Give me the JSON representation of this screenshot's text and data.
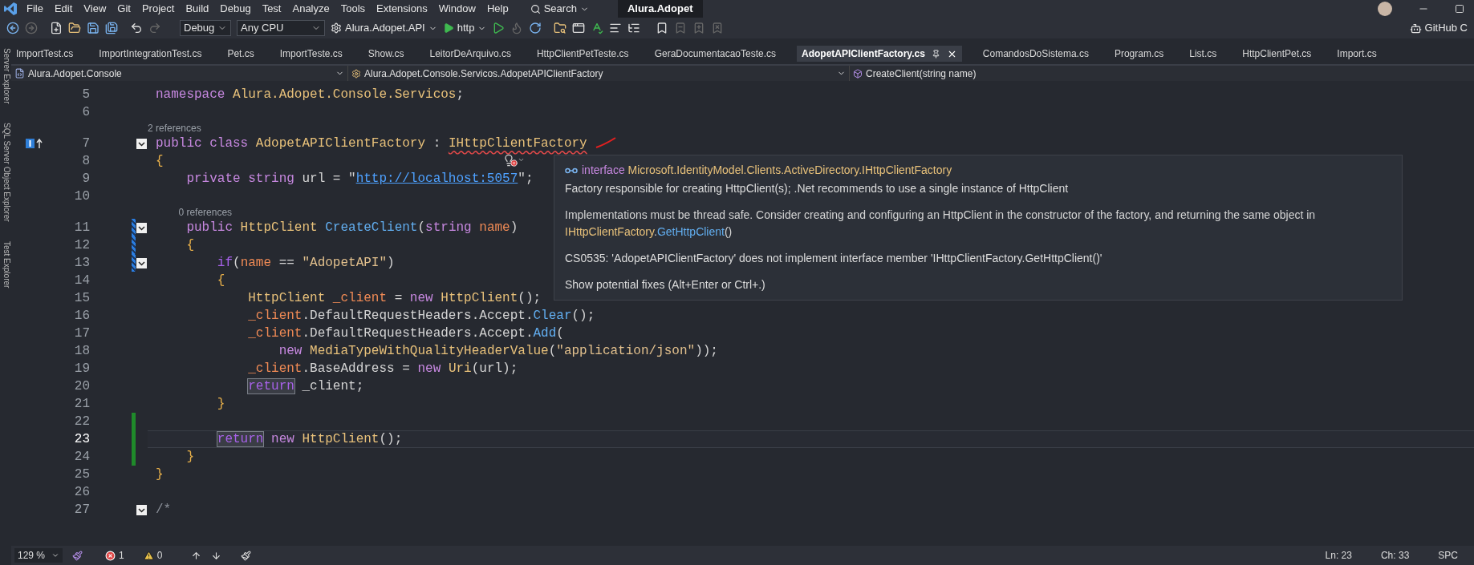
{
  "menu": {
    "items": [
      "File",
      "Edit",
      "View",
      "Git",
      "Project",
      "Build",
      "Debug",
      "Test",
      "Analyze",
      "Tools",
      "Extensions",
      "Window",
      "Help"
    ],
    "search": "Search",
    "solution_title": "Alura.Adopet"
  },
  "toolbar": {
    "configuration": "Debug",
    "platform": "Any CPU",
    "startup_project": "Alura.Adopet.API",
    "launch_profile": "http",
    "account": "GitHub C"
  },
  "side_panels": [
    "Server Explorer",
    "SQL Server Object Explorer",
    "Test Explorer"
  ],
  "tabs": [
    {
      "label": "ImportTest.cs",
      "selected": false
    },
    {
      "label": "ImportIntegrationTest.cs",
      "selected": false
    },
    {
      "label": "Pet.cs",
      "selected": false
    },
    {
      "label": "ImportTeste.cs",
      "selected": false
    },
    {
      "label": "Show.cs",
      "selected": false
    },
    {
      "label": "LeitorDeArquivo.cs",
      "selected": false
    },
    {
      "label": "HttpClientPetTeste.cs",
      "selected": false
    },
    {
      "label": "GeraDocumentacaoTeste.cs",
      "selected": false
    },
    {
      "label": "AdopetAPIClientFactory.cs",
      "selected": true
    },
    {
      "label": "ComandosDoSistema.cs",
      "selected": false
    },
    {
      "label": "Program.cs",
      "selected": false
    },
    {
      "label": "List.cs",
      "selected": false
    },
    {
      "label": "HttpClientPet.cs",
      "selected": false
    },
    {
      "label": "Import.cs",
      "selected": false
    }
  ],
  "navigation": {
    "project": "Alura.Adopet.Console",
    "type": "Alura.Adopet.Console.Servicos.AdopetAPIClientFactory",
    "member": "CreateClient(string name)"
  },
  "editor": {
    "lines": [
      {
        "number": "5",
        "current": false,
        "tokens": [
          {
            "text": "namespace",
            "kind": "kw"
          },
          {
            "text": " Alura.Adopet.Console.Servicos",
            "kind": "type"
          },
          {
            "text": ";",
            "kind": "plain"
          }
        ]
      },
      {
        "number": "6",
        "current": false
      },
      {
        "references": "2 references"
      },
      {
        "number": "7",
        "current": false,
        "fold": true,
        "implements": true,
        "tokens": [
          {
            "text": "public class",
            "kind": "kw"
          },
          {
            "text": " AdopetAPIClientFactory",
            "kind": "type"
          },
          {
            "text": " : ",
            "kind": "plain"
          },
          {
            "text": "IHttpClientFactory",
            "kind": "type_error"
          }
        ]
      },
      {
        "number": "8",
        "current": false,
        "tokens": [
          {
            "text": "{",
            "kind": "brace"
          }
        ]
      },
      {
        "number": "9",
        "current": false,
        "tokens": [
          {
            "text": "    private string",
            "kind": "kw"
          },
          {
            "text": " url = \"",
            "kind": "plain"
          },
          {
            "text": "http://localhost:5057",
            "kind": "link"
          },
          {
            "text": "\";",
            "kind": "plain"
          }
        ]
      },
      {
        "number": "10",
        "current": false
      },
      {
        "references": "0 references"
      },
      {
        "number": "11",
        "current": false,
        "fold": true,
        "reverted_change": true,
        "tokens": [
          {
            "text": "    public",
            "kind": "kw"
          },
          {
            "text": " HttpClient",
            "kind": "type"
          },
          {
            "text": " CreateClient",
            "kind": "method"
          },
          {
            "text": "(",
            "kind": "plain"
          },
          {
            "text": "string",
            "kind": "kw"
          },
          {
            "text": " name",
            "kind": "var"
          },
          {
            "text": ")",
            "kind": "plain"
          }
        ]
      },
      {
        "number": "12",
        "current": false,
        "reverted_change": true,
        "tokens": [
          {
            "text": "    {",
            "kind": "brace"
          }
        ]
      },
      {
        "number": "13",
        "current": false,
        "fold": true,
        "reverted_change": true,
        "tokens": [
          {
            "text": "        if",
            "kind": "ctl"
          },
          {
            "text": "(",
            "kind": "plain"
          },
          {
            "text": "name",
            "kind": "var"
          },
          {
            "text": " == ",
            "kind": "plain"
          },
          {
            "text": "\"AdopetAPI\"",
            "kind": "str"
          },
          {
            "text": ")",
            "kind": "plain"
          }
        ]
      },
      {
        "number": "14",
        "current": false,
        "tokens": [
          {
            "text": "        {",
            "kind": "brace"
          }
        ]
      },
      {
        "number": "15",
        "current": false,
        "tokens": [
          {
            "text": "            HttpClient",
            "kind": "type"
          },
          {
            "text": " _client",
            "kind": "var"
          },
          {
            "text": " = ",
            "kind": "plain"
          },
          {
            "text": "new",
            "kind": "kw"
          },
          {
            "text": " HttpClient",
            "kind": "type"
          },
          {
            "text": "();",
            "kind": "plain"
          }
        ]
      },
      {
        "number": "16",
        "current": false,
        "tokens": [
          {
            "text": "            _client",
            "kind": "var"
          },
          {
            "text": ".DefaultRequestHeaders.Accept.",
            "kind": "plain"
          },
          {
            "text": "Clear",
            "kind": "method"
          },
          {
            "text": "();",
            "kind": "plain"
          }
        ]
      },
      {
        "number": "17",
        "current": false,
        "tokens": [
          {
            "text": "            _client",
            "kind": "var"
          },
          {
            "text": ".DefaultRequestHeaders.Accept.",
            "kind": "plain"
          },
          {
            "text": "Add",
            "kind": "method"
          },
          {
            "text": "(",
            "kind": "plain"
          }
        ]
      },
      {
        "number": "18",
        "current": false,
        "tokens": [
          {
            "text": "                new",
            "kind": "kw"
          },
          {
            "text": " MediaTypeWithQualityHeaderValue",
            "kind": "type"
          },
          {
            "text": "(",
            "kind": "plain"
          },
          {
            "text": "\"application/json\"",
            "kind": "str"
          },
          {
            "text": "));",
            "kind": "plain"
          }
        ]
      },
      {
        "number": "19",
        "current": false,
        "tokens": [
          {
            "text": "            _client",
            "kind": "var"
          },
          {
            "text": ".BaseAddress = ",
            "kind": "plain"
          },
          {
            "text": "new",
            "kind": "kw"
          },
          {
            "text": " Uri",
            "kind": "type"
          },
          {
            "text": "(url);",
            "kind": "plain"
          }
        ]
      },
      {
        "number": "20",
        "current": false,
        "tokens": [
          {
            "text": "            return",
            "kind": "ctl_boxed"
          },
          {
            "text": " _client;",
            "kind": "plain"
          }
        ]
      },
      {
        "number": "21",
        "current": false,
        "tokens": [
          {
            "text": "        }",
            "kind": "brace"
          }
        ]
      },
      {
        "number": "22",
        "current": false,
        "saved_change": true
      },
      {
        "number": "23",
        "current": true,
        "saved_change": true,
        "tokens": [
          {
            "text": "        return",
            "kind": "ctl_boxed"
          },
          {
            "text": " new",
            "kind": "kw"
          },
          {
            "text": " HttpClient",
            "kind": "type"
          },
          {
            "text": "();",
            "kind": "plain"
          }
        ]
      },
      {
        "number": "24",
        "current": false,
        "saved_change": true,
        "tokens": [
          {
            "text": "    }",
            "kind": "brace"
          }
        ]
      },
      {
        "number": "25",
        "current": false,
        "tokens": [
          {
            "text": "}",
            "kind": "brace"
          }
        ]
      },
      {
        "number": "26",
        "current": false
      },
      {
        "number": "27",
        "current": false,
        "fold": true,
        "tokens": [
          {
            "text": "/*",
            "kind": "comment"
          }
        ]
      }
    ]
  },
  "quick_info": {
    "header": [
      {
        "text": "interface",
        "kind": "kw"
      },
      {
        "text": " Microsoft.IdentityModel.Clients.ActiveDirectory.IHttpClientFactory",
        "kind": "type"
      }
    ],
    "summary": "Factory responsible for creating HttpClient(s); .Net recommends to use a single instance of HttpClient",
    "remarks": [
      {
        "text": "Implementations must be thread safe. Consider creating and configuring an HttpClient in the constructor of the factory, and returning the same object in ",
        "kind": "plain"
      },
      {
        "text": "IHttpClientFactory",
        "kind": "type"
      },
      {
        "text": ".",
        "kind": "plain"
      },
      {
        "text": "GetHttpClient",
        "kind": "method"
      },
      {
        "text": "()",
        "kind": "plain"
      }
    ],
    "error": "CS0535: 'AdopetAPIClientFactory' does not implement interface member 'IHttpClientFactory.GetHttpClient()'",
    "fixes": "Show potential fixes (Alt+Enter or Ctrl+.)"
  },
  "status_bar": {
    "zoom": "129 %",
    "errors": "1",
    "warnings": "0",
    "line": "Ln: 23",
    "column": "Ch: 33",
    "whitespace": "SPC"
  }
}
